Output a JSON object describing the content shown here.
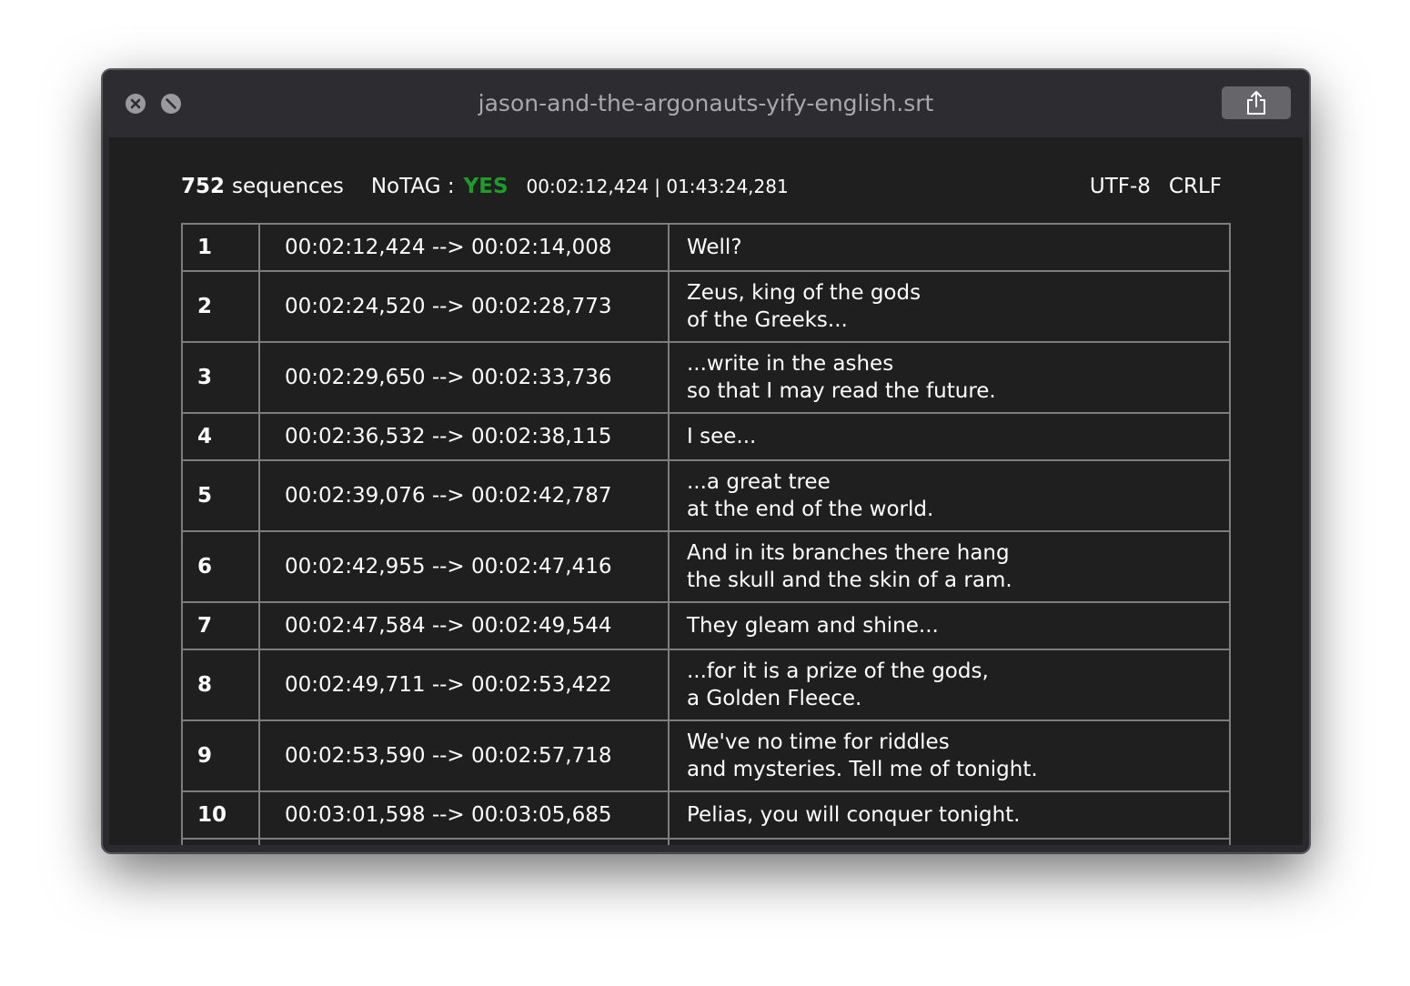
{
  "window": {
    "title": "jason-and-the-argonauts-yify-english.srt"
  },
  "icons": {
    "close": "close-icon",
    "minimize": "minimize-icon",
    "share": "share-icon"
  },
  "colors": {
    "accent_yes": "#1f9b2c",
    "background": "#1f1f1f",
    "titlebar": "#2d2c31"
  },
  "info": {
    "sequence_count": "752",
    "sequence_label": "sequences",
    "notag_label": "NoTAG :",
    "notag_value": "YES",
    "time_range": "00:02:12,424 | 01:43:24,281",
    "encoding": "UTF-8",
    "line_ending": "CRLF"
  },
  "rows": [
    {
      "num": "1",
      "time": "00:02:12,424 --> 00:02:14,008",
      "lines": [
        "Well?"
      ]
    },
    {
      "num": "2",
      "time": "00:02:24,520 --> 00:02:28,773",
      "lines": [
        "Zeus, king of the gods",
        "of the Greeks..."
      ]
    },
    {
      "num": "3",
      "time": "00:02:29,650 --> 00:02:33,736",
      "lines": [
        "...write in the ashes",
        "so that I may read the future."
      ]
    },
    {
      "num": "4",
      "time": "00:02:36,532 --> 00:02:38,115",
      "lines": [
        "I see..."
      ]
    },
    {
      "num": "5",
      "time": "00:02:39,076 --> 00:02:42,787",
      "lines": [
        "...a great tree",
        "at the end of the world."
      ]
    },
    {
      "num": "6",
      "time": "00:02:42,955 --> 00:02:47,416",
      "lines": [
        "And in its branches there hang",
        "the skull and the skin of a ram."
      ]
    },
    {
      "num": "7",
      "time": "00:02:47,584 --> 00:02:49,544",
      "lines": [
        "They gleam and shine..."
      ]
    },
    {
      "num": "8",
      "time": "00:02:49,711 --> 00:02:53,422",
      "lines": [
        "...for it is a prize of the gods,",
        "a Golden Fleece."
      ]
    },
    {
      "num": "9",
      "time": "00:02:53,590 --> 00:02:57,718",
      "lines": [
        "We've no time for riddles",
        "and mysteries. Tell me of tonight."
      ]
    },
    {
      "num": "10",
      "time": "00:03:01,598 --> 00:03:05,685",
      "lines": [
        "Pelias, you will conquer tonight."
      ]
    },
    {
      "num": "",
      "time": "",
      "lines": [
        ""
      ]
    }
  ]
}
